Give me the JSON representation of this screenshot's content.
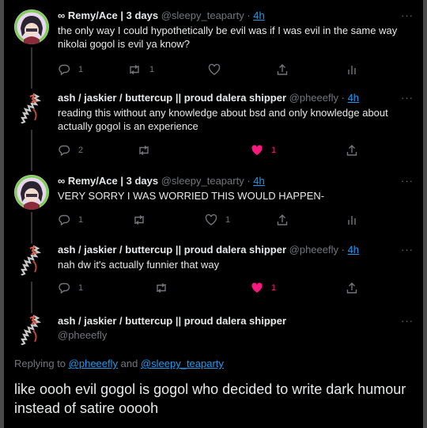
{
  "tweets": [
    {
      "name": "∞ Remy/Ace | 3 days",
      "handle": "@sleepy_teaparty",
      "sep": " · ",
      "time": "4h",
      "text": "the only way I could hypothetically be evil was if I was evil in the same way nikolai gogol is evil ya know?",
      "replies": "1",
      "retweets": "1",
      "likes": "",
      "liked": false
    },
    {
      "name": "ash / jaskier / buttercup || proud dalera shipper",
      "handle": "@pheeefly",
      "sep": " · ",
      "time": "4h",
      "text": "reading this without any knowledge about bsd and only knowledge about actually gogol is an experience",
      "replies": "2",
      "retweets": "",
      "likes": "1",
      "liked": true
    },
    {
      "name": "∞ Remy/Ace | 3 days",
      "handle": "@sleepy_teaparty",
      "sep": " · ",
      "time": "4h",
      "text": "VERY SORRY I WAS WORRIED THIS WOULD HAPPEN-",
      "replies": "1",
      "retweets": "",
      "likes": "1",
      "liked": false
    },
    {
      "name": "ash / jaskier / buttercup || proud dalera shipper",
      "handle": "@pheeefly",
      "sep": " · ",
      "time": "4h",
      "text": "nah dw it's actually funnier that way",
      "replies": "1",
      "retweets": "",
      "likes": "1",
      "liked": true
    }
  ],
  "compose": {
    "name": "ash / jaskier / buttercup || proud dalera shipper",
    "handle": "@pheeefly",
    "replying_prefix": "Replying to ",
    "replying_handle_1": "@pheeefly",
    "replying_and": " and ",
    "replying_handle_2": "@sleepy_teaparty",
    "text": "like oooh evil gogol is gogol who decided to write dark humour instead of satire ooooh"
  },
  "more_glyph": "···",
  "colors": {
    "background": "#000000",
    "text": "#e7e9ea",
    "muted": "#71767b",
    "link": "#1d9bf0",
    "like": "#f91880"
  }
}
